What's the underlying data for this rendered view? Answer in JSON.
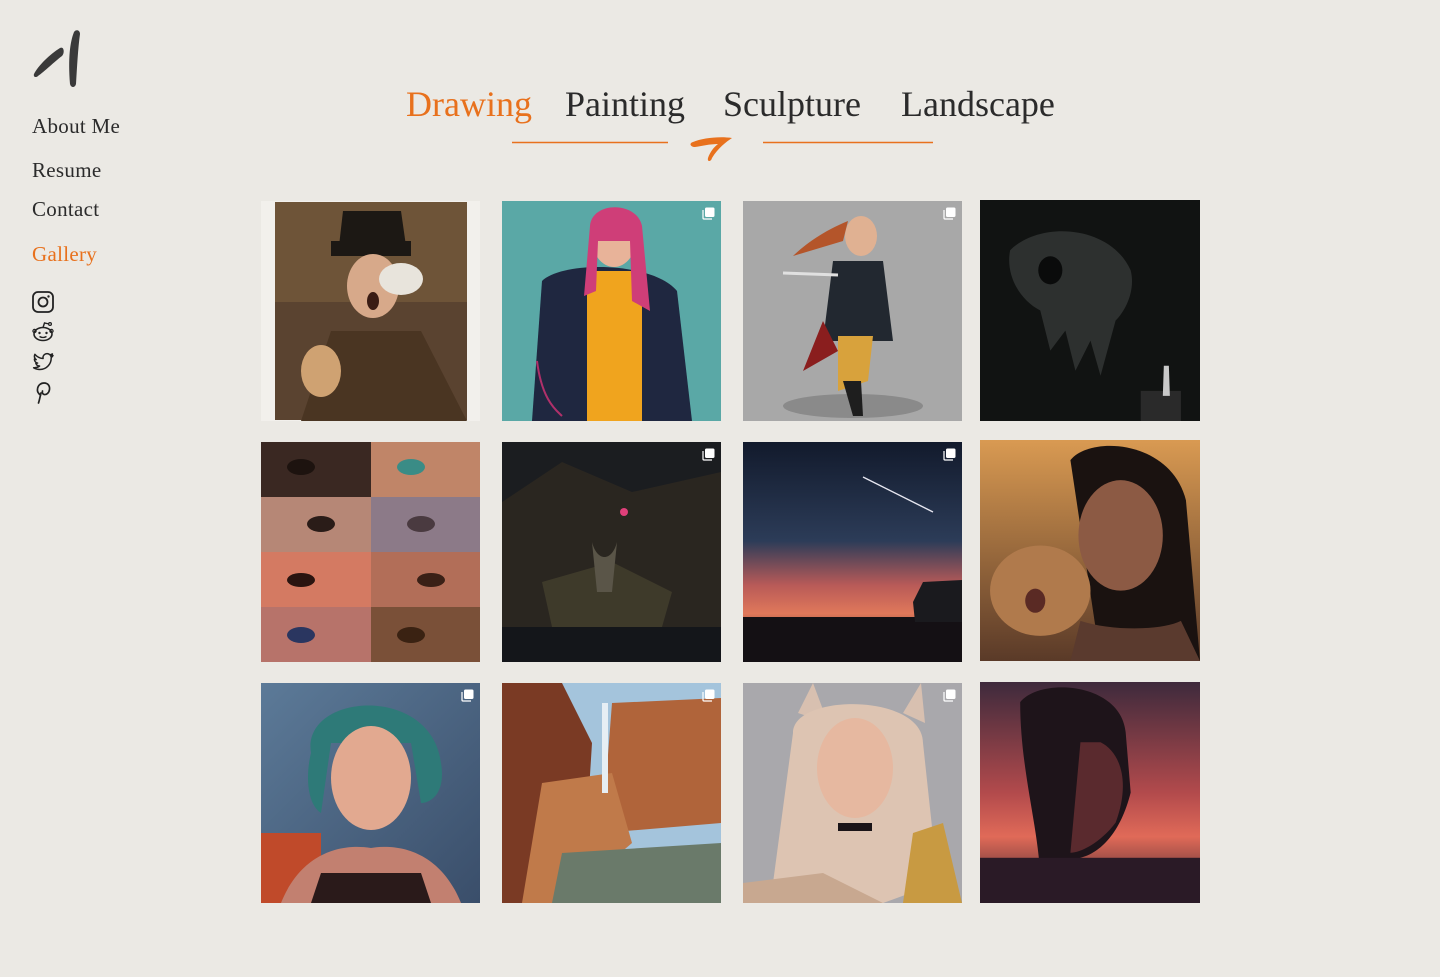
{
  "sidebar": {
    "nav": [
      {
        "label": "About Me",
        "active": false
      },
      {
        "label": "Resume",
        "active": false
      },
      {
        "label": "Contact",
        "active": false
      },
      {
        "label": "Gallery",
        "active": true
      }
    ],
    "social": [
      "instagram-icon",
      "reddit-icon",
      "twitter-icon",
      "pinterest-icon"
    ]
  },
  "tabs": [
    {
      "label": "Drawing",
      "active": true
    },
    {
      "label": "Painting",
      "active": false
    },
    {
      "label": "Sculpture",
      "active": false
    },
    {
      "label": "Landscape",
      "active": false
    }
  ],
  "colors": {
    "accent": "#e8711d",
    "background": "#ebe9e4",
    "text": "#2b2b2b"
  },
  "gallery": [
    {
      "subject": "shocked old man in top hat",
      "multi": false
    },
    {
      "subject": "pink-haired girl in bomber jacket",
      "multi": true
    },
    {
      "subject": "swordswoman leaping",
      "multi": true
    },
    {
      "subject": "skull in darkness",
      "multi": false
    },
    {
      "subject": "eyes study grid",
      "multi": false
    },
    {
      "subject": "armored figure in canyon at night",
      "multi": true
    },
    {
      "subject": "sunset with shooting star and car",
      "multi": true
    },
    {
      "subject": "woman hugging pomeranian",
      "multi": false
    },
    {
      "subject": "teal-haired woman portrait",
      "multi": true
    },
    {
      "subject": "canyon with waterfall",
      "multi": true
    },
    {
      "subject": "fox-eared girl",
      "multi": true
    },
    {
      "subject": "man in red sunset water",
      "multi": false
    }
  ]
}
